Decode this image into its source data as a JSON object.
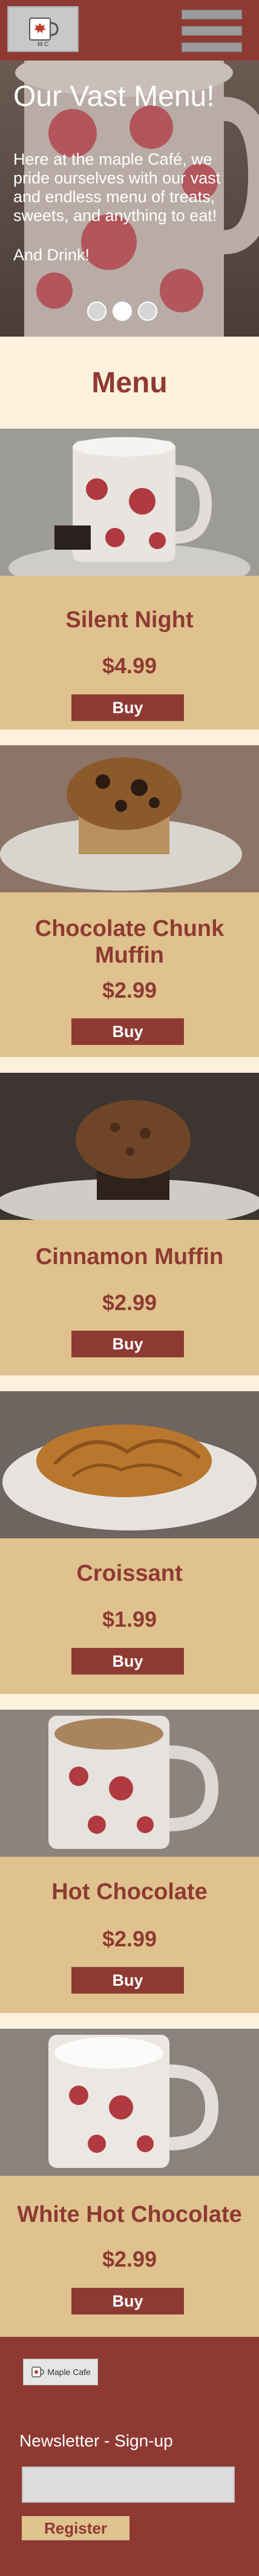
{
  "header": {
    "logo_text": "M C",
    "menu_icon": "hamburger-menu-icon"
  },
  "hero": {
    "title": "Our Vast Menu!",
    "text": "Here at the maple Café, we pride ourselves with our vast and endless menu of treats, sweets, and anything to eat!",
    "drink_text": "And Drink!",
    "slides": 3
  },
  "menu": {
    "heading": "Menu",
    "items": [
      {
        "name": "Silent Night",
        "price": "$4.99",
        "buy_label": "Buy",
        "image": "mug-of-milk-with-chocolate"
      },
      {
        "name": "Chocolate Chunk Muffin",
        "price": "$2.99",
        "buy_label": "Buy",
        "image": "chocolate-chunk-muffin"
      },
      {
        "name": "Cinnamon Muffin",
        "price": "$2.99",
        "buy_label": "Buy",
        "image": "cinnamon-muffin"
      },
      {
        "name": "Croissant",
        "price": "$1.99",
        "buy_label": "Buy",
        "image": "croissant"
      },
      {
        "name": "Hot Chocolate",
        "price": "$2.99",
        "buy_label": "Buy",
        "image": "hot-chocolate-mug"
      },
      {
        "name": "White Hot Chocolate",
        "price": "$2.99",
        "buy_label": "Buy",
        "image": "white-hot-chocolate-mug"
      }
    ]
  },
  "footer": {
    "logo_text": "Maple Cafe",
    "newsletter_label": "Newsletter - Sign-up",
    "newsletter_placeholder": "",
    "register_label": "Register"
  },
  "colors": {
    "brand": "#8e3a33",
    "card": "#dfc28d",
    "cream": "#fcf1dc"
  }
}
